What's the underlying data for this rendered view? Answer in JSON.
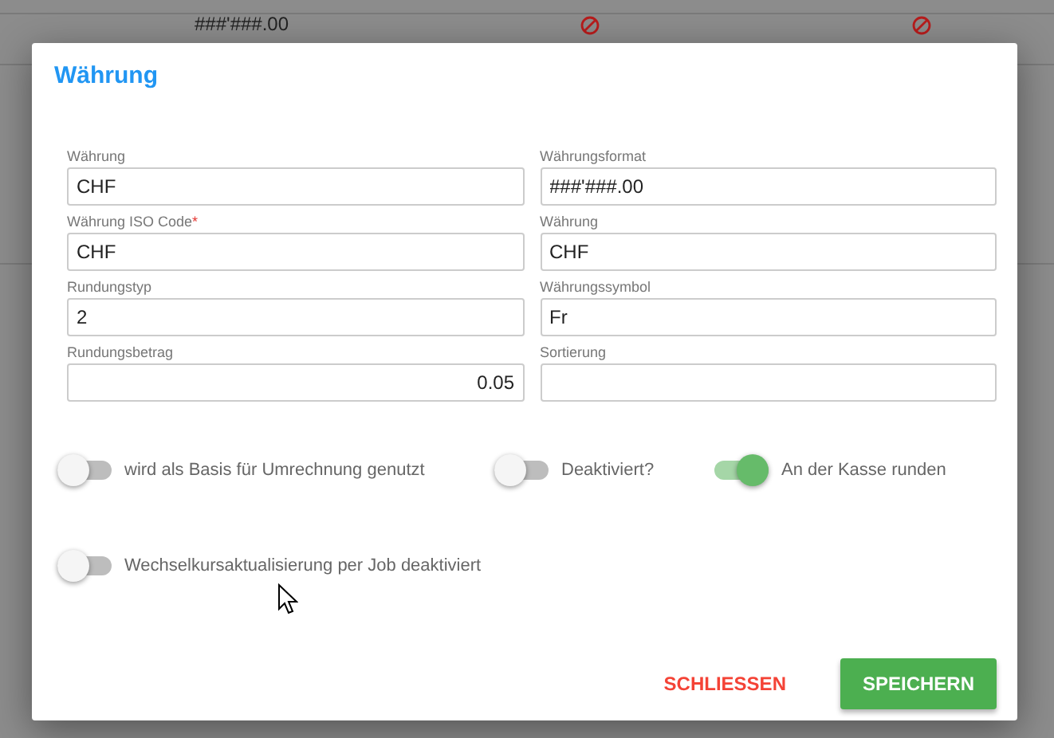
{
  "background_table": {
    "format": "###'###.00",
    "icons": [
      {
        "kind": "blocked"
      },
      {
        "kind": "blocked"
      }
    ]
  },
  "dialog": {
    "title": "Währung",
    "fields": [
      {
        "label": "Währung",
        "value": "CHF",
        "kind": "text"
      },
      {
        "label": "Währungsformat",
        "value": "###'###.00",
        "kind": "text"
      },
      {
        "label": "Währung ISO Code",
        "required_mark": "*",
        "value": "CHF",
        "kind": "text"
      },
      {
        "label": "Währung",
        "value": "CHF",
        "kind": "text"
      },
      {
        "label": "Rundungstyp",
        "value": "2",
        "kind": "text"
      },
      {
        "label": "Währungssymbol",
        "value": "Fr",
        "kind": "text"
      },
      {
        "label": "Rundungsbetrag",
        "value": "0.05",
        "kind": "numeric"
      },
      {
        "label": "Sortierung",
        "kind": "text"
      }
    ],
    "toggles": [
      {
        "label": "wird als Basis für Umrechnung genutzt",
        "on": false
      },
      {
        "label": "Deaktiviert?",
        "on": false
      },
      {
        "label": "An der Kasse runden",
        "on": true
      },
      {
        "label": "Wechselkursaktualisierung per Job deaktiviert",
        "on": false
      }
    ],
    "buttons": [
      {
        "label": "SCHLIESSEN",
        "kind": "flat"
      },
      {
        "label": "SPEICHERN",
        "kind": "raised"
      }
    ]
  }
}
